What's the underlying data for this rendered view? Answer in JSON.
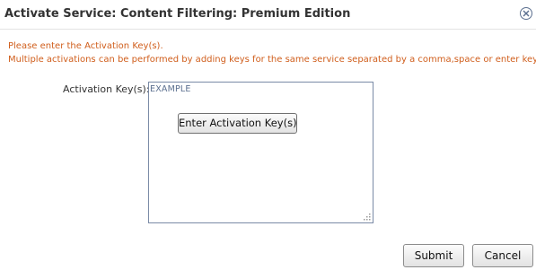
{
  "dialog": {
    "title": "Activate Service: Content Filtering: Premium Edition",
    "close_icon": "close-circle-icon"
  },
  "instructions": {
    "line1": "Please enter the Activation Key(s).",
    "line2": "Multiple activations can be performed by adding keys for the same service separated by a comma,space or enter key."
  },
  "form": {
    "key_label": "Activation Key(s):",
    "key_placeholder": "EXAMPLE",
    "enter_key_button": "Enter Activation Key(s)"
  },
  "actions": {
    "submit_label": "Submit",
    "cancel_label": "Cancel"
  },
  "colors": {
    "instruction_text": "#d05e1c",
    "title_text": "#333333",
    "textarea_border": "#7a8aa6"
  }
}
